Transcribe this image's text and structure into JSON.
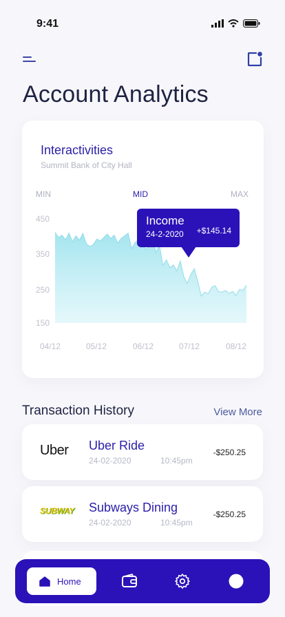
{
  "status": {
    "time": "9:41"
  },
  "header": {
    "title": "Account Analytics"
  },
  "chart_card": {
    "title": "Interactivities",
    "subtitle": "Summit Bank of City Hall",
    "range": {
      "min": "MIN",
      "mid": "MID",
      "max": "MAX"
    },
    "tooltip": {
      "label": "Income",
      "date": "24-2-2020",
      "amount": "+$145.14"
    }
  },
  "chart_data": {
    "type": "area",
    "title": "Interactivities",
    "subtitle": "Summit Bank of City Hall",
    "x_ticks": [
      "04/12",
      "05/12",
      "06/12",
      "07/12",
      "08/12"
    ],
    "y_ticks": [
      450,
      350,
      250,
      150
    ],
    "ylim": [
      150,
      460
    ],
    "grid": false,
    "color": "#a9e7f0",
    "series": [
      {
        "values": [
          420,
          405,
          412,
          398,
          418,
          392,
          410,
          397,
          417,
          386,
          378,
          384,
          400,
          395,
          405,
          415,
          402,
          412,
          388,
          402,
          410,
          418,
          372,
          390,
          398,
          408,
          368,
          380,
          405,
          360,
          382,
          322,
          338,
          315,
          323,
          305,
          335,
          288,
          268,
          294,
          312,
          275,
          230,
          242,
          237,
          256,
          261,
          243,
          242,
          247,
          238,
          244,
          232,
          250,
          247,
          263
        ]
      }
    ],
    "tooltip": {
      "label": "Income",
      "date": "24-2-2020",
      "value": "+$145.14"
    }
  },
  "transactions": {
    "title": "Transaction History",
    "view_more": "View More",
    "items": [
      {
        "logo": "Uber",
        "name": "Uber Ride",
        "date": "24-02-2020",
        "time": "10:45pm",
        "amount": "-$250.25"
      },
      {
        "logo": "SUBWAY",
        "name": "Subways Dining",
        "date": "24-02-2020",
        "time": "10:45pm",
        "amount": "-$250.25"
      }
    ]
  },
  "nav": {
    "home_label": "Home"
  },
  "colors": {
    "primary": "#2a12b8",
    "accent_text": "#2a1fa8",
    "area_fill": "#a9e7f0",
    "background": "#f7f7fb"
  }
}
